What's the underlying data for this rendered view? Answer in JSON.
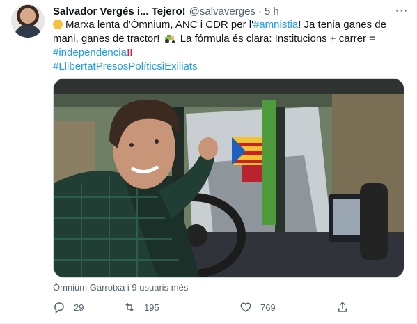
{
  "tweet": {
    "author_name": "Salvador Vergés i... Tejero!",
    "handle": "@salvaverges",
    "separator": "·",
    "time": "5 h",
    "more_label": "···",
    "text": {
      "line1_a": "Marxa lenta d'Òmnium, ANC i CDR per l'",
      "hashtag_amnistia": "#amnistia",
      "line1_b": "! Ja tenia ganes de",
      "line2_a": "mani, ganes de tractor!",
      "line2_b": "La fórmula és clara: Institucions + carrer =",
      "hashtag_independencia": "#independència",
      "exclamation": "‼",
      "hashtag_llibertat": "#LlibertatPresosPolíticsiExiliats"
    },
    "media_caption": "Òmnium Garrotxa i 9 usuaris més",
    "actions": {
      "replies": "29",
      "retweets": "195",
      "likes": "769"
    }
  },
  "colors": {
    "link": "#1d9bf0",
    "secondary_text": "#536471",
    "primary_text": "#0f1419"
  },
  "icons": {
    "reply": "speech-bubble-icon",
    "retweet": "retweet-arrows-icon",
    "like": "heart-icon",
    "share": "share-upload-icon",
    "more": "ellipsis-icon",
    "tractor": "tractor-emoji",
    "yellow_circle": "yellow-circle-emoji"
  }
}
